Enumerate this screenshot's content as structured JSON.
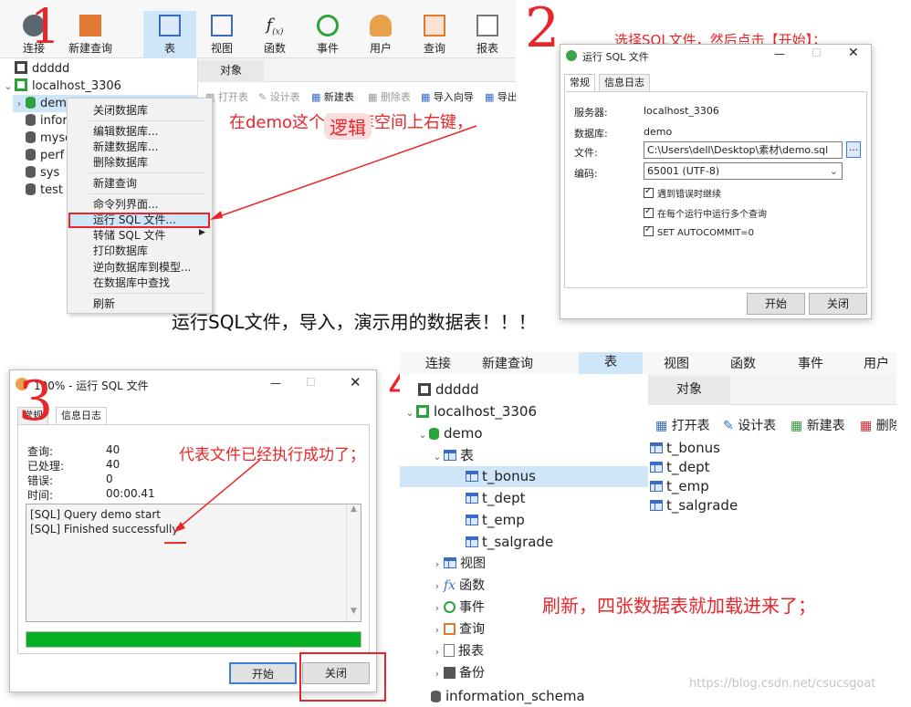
{
  "panel1": {
    "toolbar": {
      "connect": "连接",
      "new_query": "新建查询",
      "table": "表",
      "view": "视图",
      "function": "函数",
      "event": "事件",
      "user": "用户",
      "query": "查询",
      "report": "报表"
    },
    "tree": {
      "conn1": "ddddd",
      "conn2": "localhost_3306",
      "dbs": [
        "demo",
        "infor",
        "mysq",
        "perf",
        "sys",
        "test"
      ]
    },
    "objects_tab": "对象",
    "obj_toolbar": [
      "打开表",
      "设计表",
      "新建表",
      "删除表",
      "导入向导",
      "导出"
    ],
    "context_menu": [
      "关闭数据库",
      "编辑数据库...",
      "新建数据库...",
      "删除数据库",
      "新建查询",
      "命令列界面...",
      "运行 SQL 文件...",
      "转储 SQL 文件",
      "打印数据库",
      "逆向数据库到模型...",
      "在数据库中查找",
      "刷新"
    ],
    "annotation": "在demo这个数据库空间上右键，",
    "annotation_mid": "逻辑",
    "step_number": "1"
  },
  "panel2": {
    "step_number": "2",
    "annotation": "选择SQL文件，然后点击【开始】；",
    "dialog_title": "运行 SQL 文件",
    "tabs": [
      "常规",
      "信息日志"
    ],
    "server_label": "服务器:",
    "server_value": "localhost_3306",
    "db_label": "数据库:",
    "db_value": "demo",
    "file_label": "文件:",
    "file_value": "C:\\Users\\dell\\Desktop\\素材\\demo.sql",
    "encoding_label": "编码:",
    "encoding_value": "65001 (UTF-8)",
    "options": [
      "遇到错误时继续",
      "在每个运行中运行多个查询",
      "SET AUTOCOMMIT=0"
    ],
    "start_button": "开始",
    "close_button": "关闭"
  },
  "caption": "运行SQL文件，导入，演示用的数据表！！！",
  "panel3": {
    "step_number": "3",
    "dialog_title": "100% - 运行 SQL 文件",
    "tabs": [
      "常规",
      "信息日志"
    ],
    "stats": [
      {
        "label": "查询:",
        "value": "40"
      },
      {
        "label": "已处理:",
        "value": "40"
      },
      {
        "label": "错误:",
        "value": "0"
      },
      {
        "label": "时间:",
        "value": "00:00.41"
      }
    ],
    "log": [
      "[SQL] Query demo start",
      "[SQL] Finished successfully"
    ],
    "annotation": "代表文件已经执行成功了；",
    "progress": 1.0,
    "start_button": "开始",
    "close_button": "关闭"
  },
  "panel4": {
    "step_number": "4",
    "toolbar": {
      "connect": "连接",
      "new_query": "新建查询",
      "table": "表",
      "view": "视图",
      "function": "函数",
      "event": "事件",
      "user": "用户"
    },
    "tree": {
      "conn1": "ddddd",
      "conn2": "localhost_3306",
      "db": "demo",
      "tables_node": "表",
      "tables": [
        "t_bonus",
        "t_dept",
        "t_emp",
        "t_salgrade"
      ],
      "others": [
        "视图",
        "函数",
        "事件",
        "查询",
        "报表",
        "备份"
      ],
      "next_db": "information_schema"
    },
    "objects_tab": "对象",
    "obj_toolbar": [
      "打开表",
      "设计表",
      "新建表",
      "删除"
    ],
    "object_list": [
      "t_bonus",
      "t_dept",
      "t_emp",
      "t_salgrade"
    ],
    "annotation": "刷新，四张数据表就加载进来了；"
  },
  "watermark": "https://blog.csdn.net/csucsgoat",
  "colors": {
    "annotation": "#e8262a",
    "selected": "#cfe5f8",
    "progress": "#06b025"
  }
}
